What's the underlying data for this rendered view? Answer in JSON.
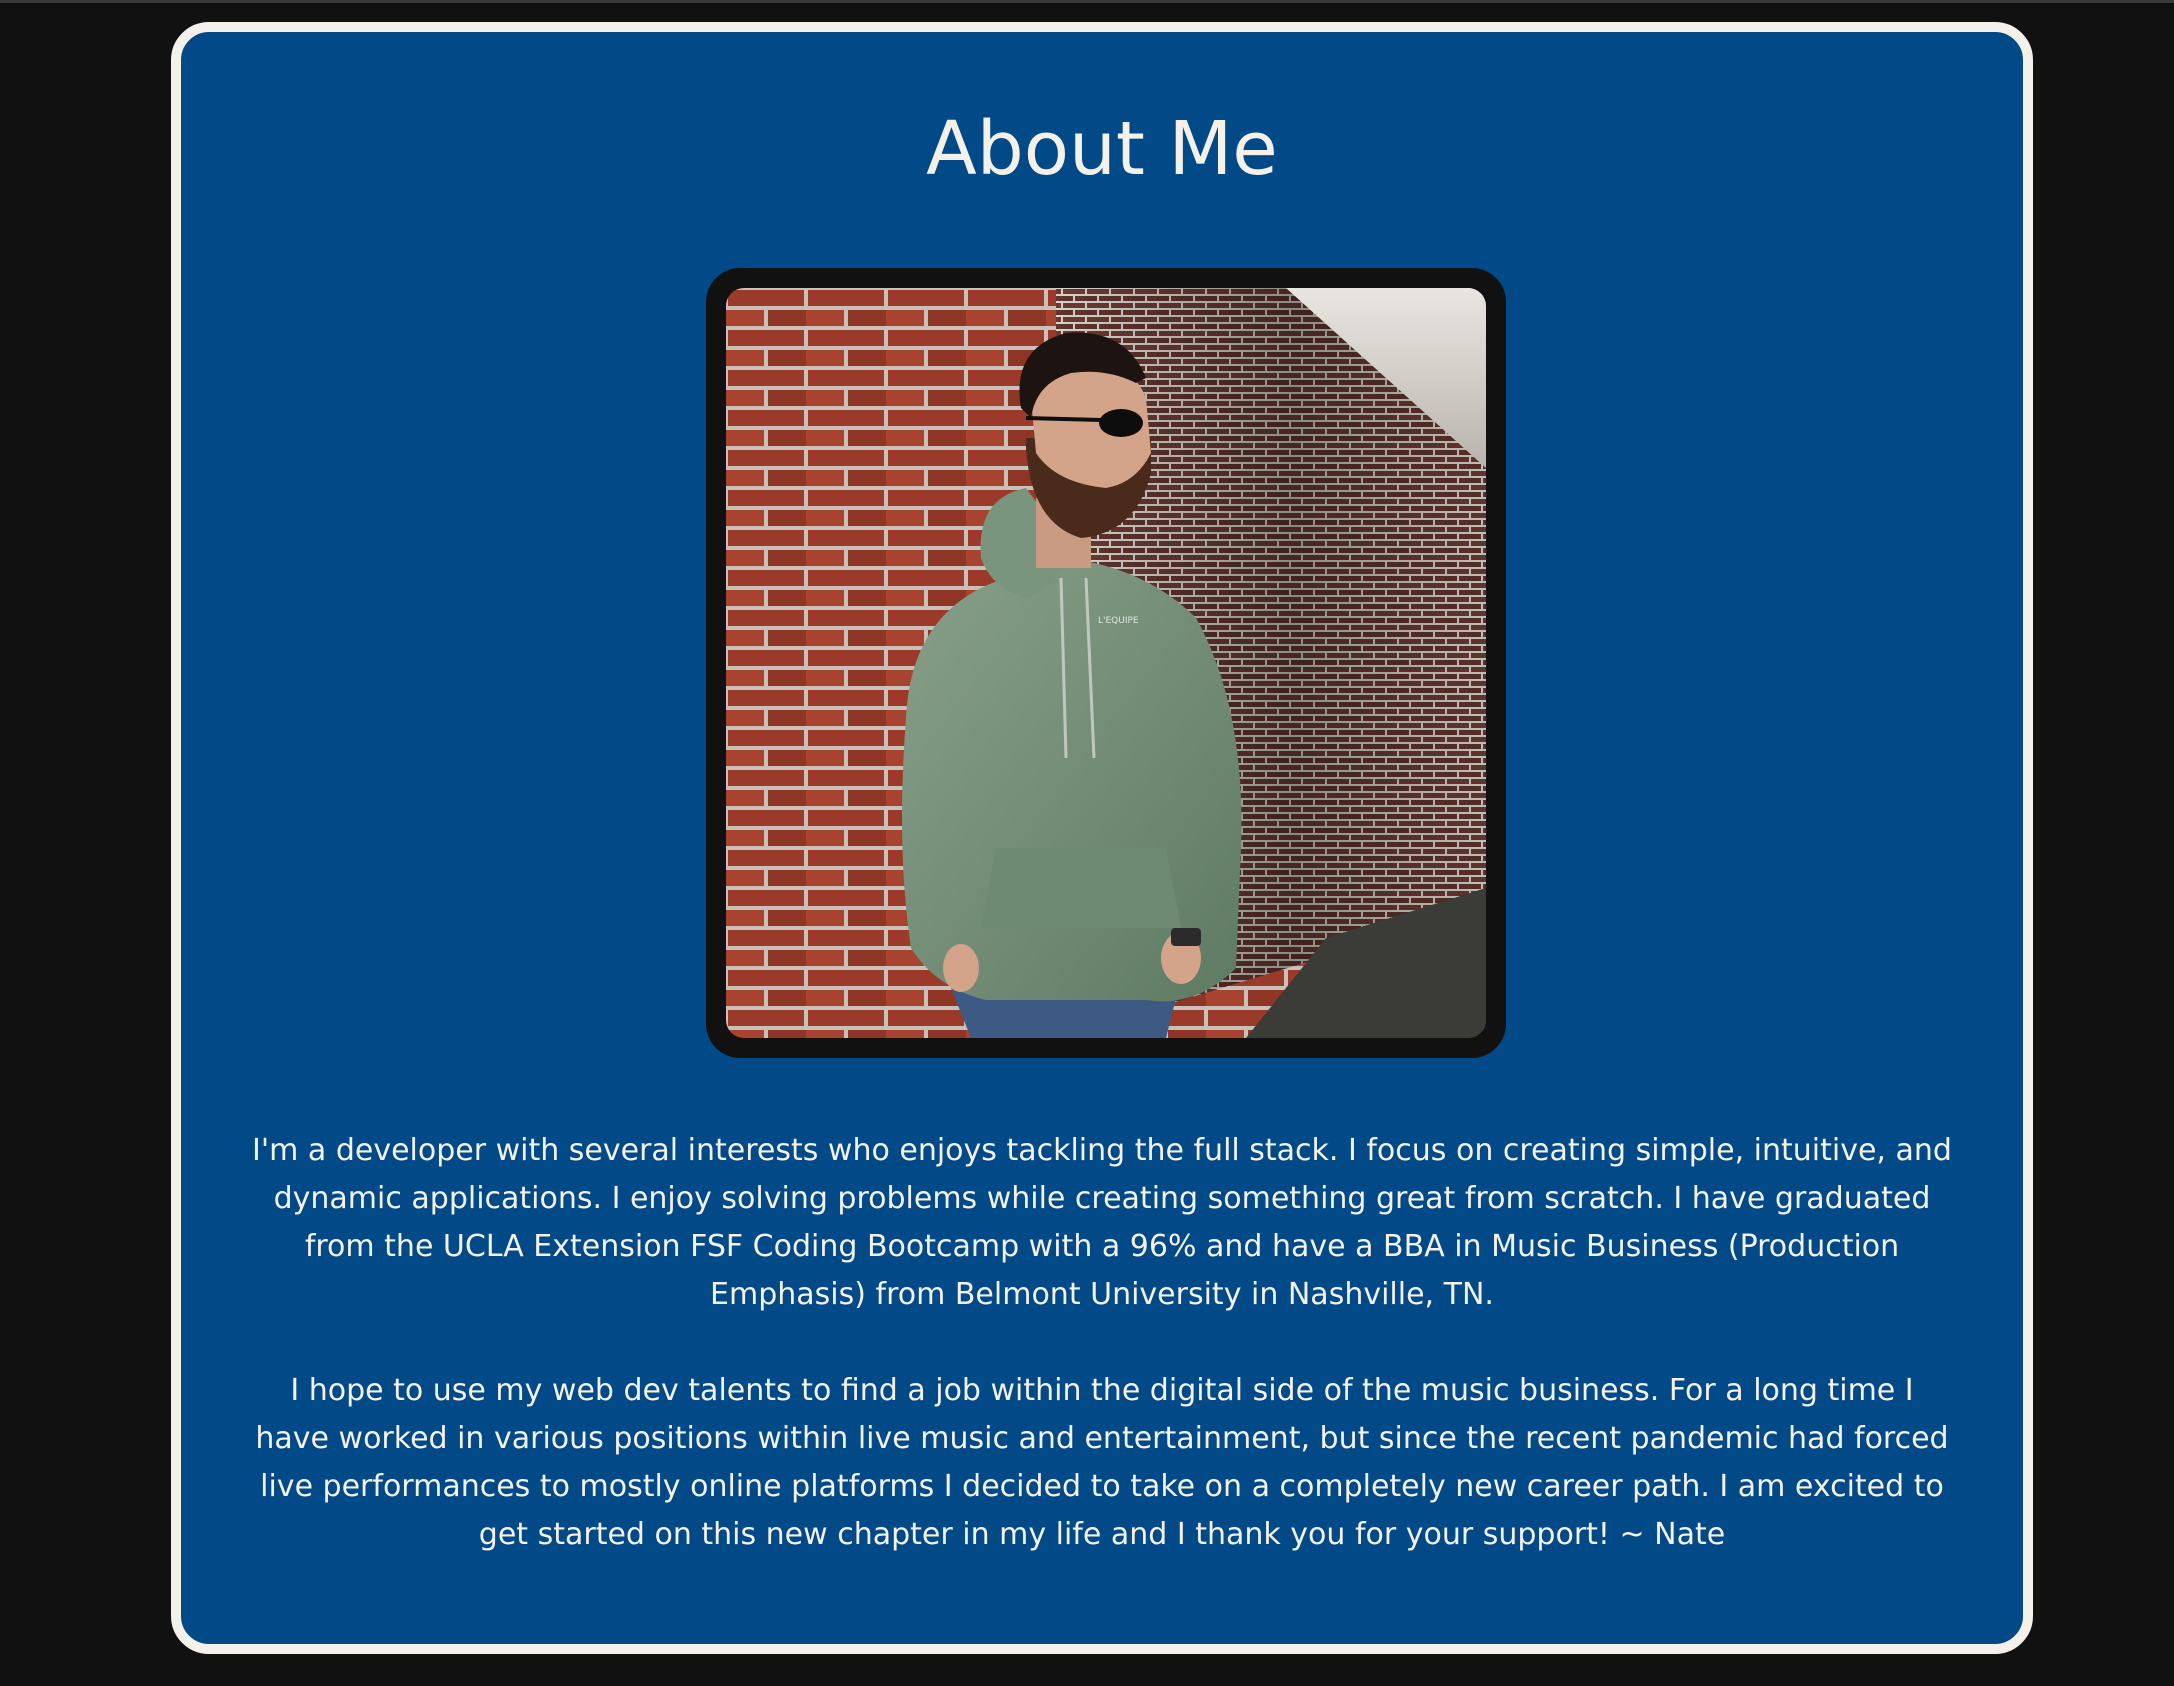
{
  "page": {
    "title": "About Me",
    "photo_alt": "Portrait of a bearded man in sunglasses and a green hoodie leaning against a brick wall",
    "bio": [
      "I'm a developer with several interests who enjoys tackling the full stack. I focus on creating simple, intuitive, and dynamic applications. I enjoy solving problems while creating something great from scratch. I have graduated from the UCLA Extension FSF Coding Bootcamp with a 96% and have a BBA in Music Business (Production Emphasis) from Belmont University in Nashville, TN.",
      "I hope to use my web dev talents to find a job within the digital side of the music business. For a long time I have worked in various positions within live music and entertainment, but since the recent pandemic had forced live performances to mostly online platforms I decided to take on a completely new career path. I am excited to get started on this new chapter in my life and I thank you for your support! ~ Nate"
    ],
    "hoodie_text": "L'EQUIPE"
  },
  "colors": {
    "background": "#111111",
    "card": "#024a87",
    "card_border": "#f4f1ea",
    "text": "#f4f1ea",
    "photo_frame": "#111111"
  }
}
